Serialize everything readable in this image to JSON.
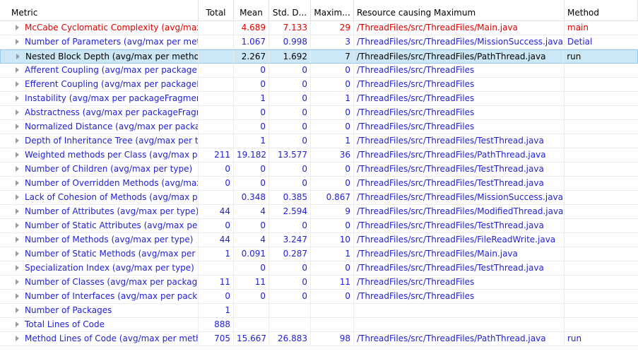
{
  "columns": [
    "Metric",
    "Total",
    "Mean",
    "Std. D...",
    "Maxim...",
    "Resource causing Maximum",
    "Method"
  ],
  "rows": [
    {
      "metric": "McCabe Cyclomatic Complexity (avg/max per method)",
      "total": "",
      "mean": "4.689",
      "std": "7.133",
      "max": "29",
      "resource": "/ThreadFiles/src/ThreadFiles/Main.java",
      "method": "main",
      "color": "red"
    },
    {
      "metric": "Number of Parameters (avg/max per method)",
      "total": "",
      "mean": "1.067",
      "std": "0.998",
      "max": "3",
      "resource": "/ThreadFiles/src/ThreadFiles/MissionSuccess.java",
      "method": "Detial",
      "color": "blue"
    },
    {
      "metric": "Nested Block Depth (avg/max per method)",
      "total": "",
      "mean": "2.267",
      "std": "1.692",
      "max": "7",
      "resource": "/ThreadFiles/src/ThreadFiles/PathThread.java",
      "method": "run",
      "color": "black",
      "selected": true
    },
    {
      "metric": "Afferent Coupling (avg/max per packageFragment)",
      "total": "",
      "mean": "0",
      "std": "0",
      "max": "0",
      "resource": "/ThreadFiles/src/ThreadFiles",
      "method": "",
      "color": "blue"
    },
    {
      "metric": "Efferent Coupling (avg/max per packageFragment)",
      "total": "",
      "mean": "0",
      "std": "0",
      "max": "0",
      "resource": "/ThreadFiles/src/ThreadFiles",
      "method": "",
      "color": "blue"
    },
    {
      "metric": "Instability (avg/max per packageFragment)",
      "total": "",
      "mean": "1",
      "std": "0",
      "max": "1",
      "resource": "/ThreadFiles/src/ThreadFiles",
      "method": "",
      "color": "blue"
    },
    {
      "metric": "Abstractness (avg/max per packageFragment)",
      "total": "",
      "mean": "0",
      "std": "0",
      "max": "0",
      "resource": "/ThreadFiles/src/ThreadFiles",
      "method": "",
      "color": "blue"
    },
    {
      "metric": "Normalized Distance (avg/max per packageFragment)",
      "total": "",
      "mean": "0",
      "std": "0",
      "max": "0",
      "resource": "/ThreadFiles/src/ThreadFiles",
      "method": "",
      "color": "blue"
    },
    {
      "metric": "Depth of Inheritance Tree (avg/max per type)",
      "total": "",
      "mean": "1",
      "std": "0",
      "max": "1",
      "resource": "/ThreadFiles/src/ThreadFiles/TestThread.java",
      "method": "",
      "color": "blue"
    },
    {
      "metric": "Weighted methods per Class (avg/max per type)",
      "total": "211",
      "mean": "19.182",
      "std": "13.577",
      "max": "36",
      "resource": "/ThreadFiles/src/ThreadFiles/PathThread.java",
      "method": "",
      "color": "blue"
    },
    {
      "metric": "Number of Children (avg/max per type)",
      "total": "0",
      "mean": "0",
      "std": "0",
      "max": "0",
      "resource": "/ThreadFiles/src/ThreadFiles/TestThread.java",
      "method": "",
      "color": "blue"
    },
    {
      "metric": "Number of Overridden Methods (avg/max per type)",
      "total": "0",
      "mean": "0",
      "std": "0",
      "max": "0",
      "resource": "/ThreadFiles/src/ThreadFiles/TestThread.java",
      "method": "",
      "color": "blue"
    },
    {
      "metric": "Lack of Cohesion of Methods (avg/max per type)",
      "total": "",
      "mean": "0.348",
      "std": "0.385",
      "max": "0.867",
      "resource": "/ThreadFiles/src/ThreadFiles/MissionSuccess.java",
      "method": "",
      "color": "blue"
    },
    {
      "metric": "Number of Attributes (avg/max per type)",
      "total": "44",
      "mean": "4",
      "std": "2.594",
      "max": "9",
      "resource": "/ThreadFiles/src/ThreadFiles/ModifiedThread.java",
      "method": "",
      "color": "blue"
    },
    {
      "metric": "Number of Static Attributes (avg/max per type)",
      "total": "0",
      "mean": "0",
      "std": "0",
      "max": "0",
      "resource": "/ThreadFiles/src/ThreadFiles/TestThread.java",
      "method": "",
      "color": "blue"
    },
    {
      "metric": "Number of Methods (avg/max per type)",
      "total": "44",
      "mean": "4",
      "std": "3.247",
      "max": "10",
      "resource": "/ThreadFiles/src/ThreadFiles/FileReadWrite.java",
      "method": "",
      "color": "blue"
    },
    {
      "metric": "Number of Static Methods (avg/max per type)",
      "total": "1",
      "mean": "0.091",
      "std": "0.287",
      "max": "1",
      "resource": "/ThreadFiles/src/ThreadFiles/Main.java",
      "method": "",
      "color": "blue"
    },
    {
      "metric": "Specialization Index (avg/max per type)",
      "total": "",
      "mean": "0",
      "std": "0",
      "max": "0",
      "resource": "/ThreadFiles/src/ThreadFiles/TestThread.java",
      "method": "",
      "color": "blue"
    },
    {
      "metric": "Number of Classes (avg/max per packageFragment)",
      "total": "11",
      "mean": "11",
      "std": "0",
      "max": "11",
      "resource": "/ThreadFiles/src/ThreadFiles",
      "method": "",
      "color": "blue"
    },
    {
      "metric": "Number of Interfaces (avg/max per packageFragment)",
      "total": "0",
      "mean": "0",
      "std": "0",
      "max": "0",
      "resource": "/ThreadFiles/src/ThreadFiles",
      "method": "",
      "color": "blue"
    },
    {
      "metric": "Number of Packages",
      "total": "1",
      "mean": "",
      "std": "",
      "max": "",
      "resource": "",
      "method": "",
      "color": "blue"
    },
    {
      "metric": "Total Lines of Code",
      "total": "888",
      "mean": "",
      "std": "",
      "max": "",
      "resource": "",
      "method": "",
      "color": "blue"
    },
    {
      "metric": "Method Lines of Code (avg/max per method)",
      "total": "705",
      "mean": "15.667",
      "std": "26.883",
      "max": "98",
      "resource": "/ThreadFiles/src/ThreadFiles/PathThread.java",
      "method": "run",
      "color": "blue"
    }
  ]
}
